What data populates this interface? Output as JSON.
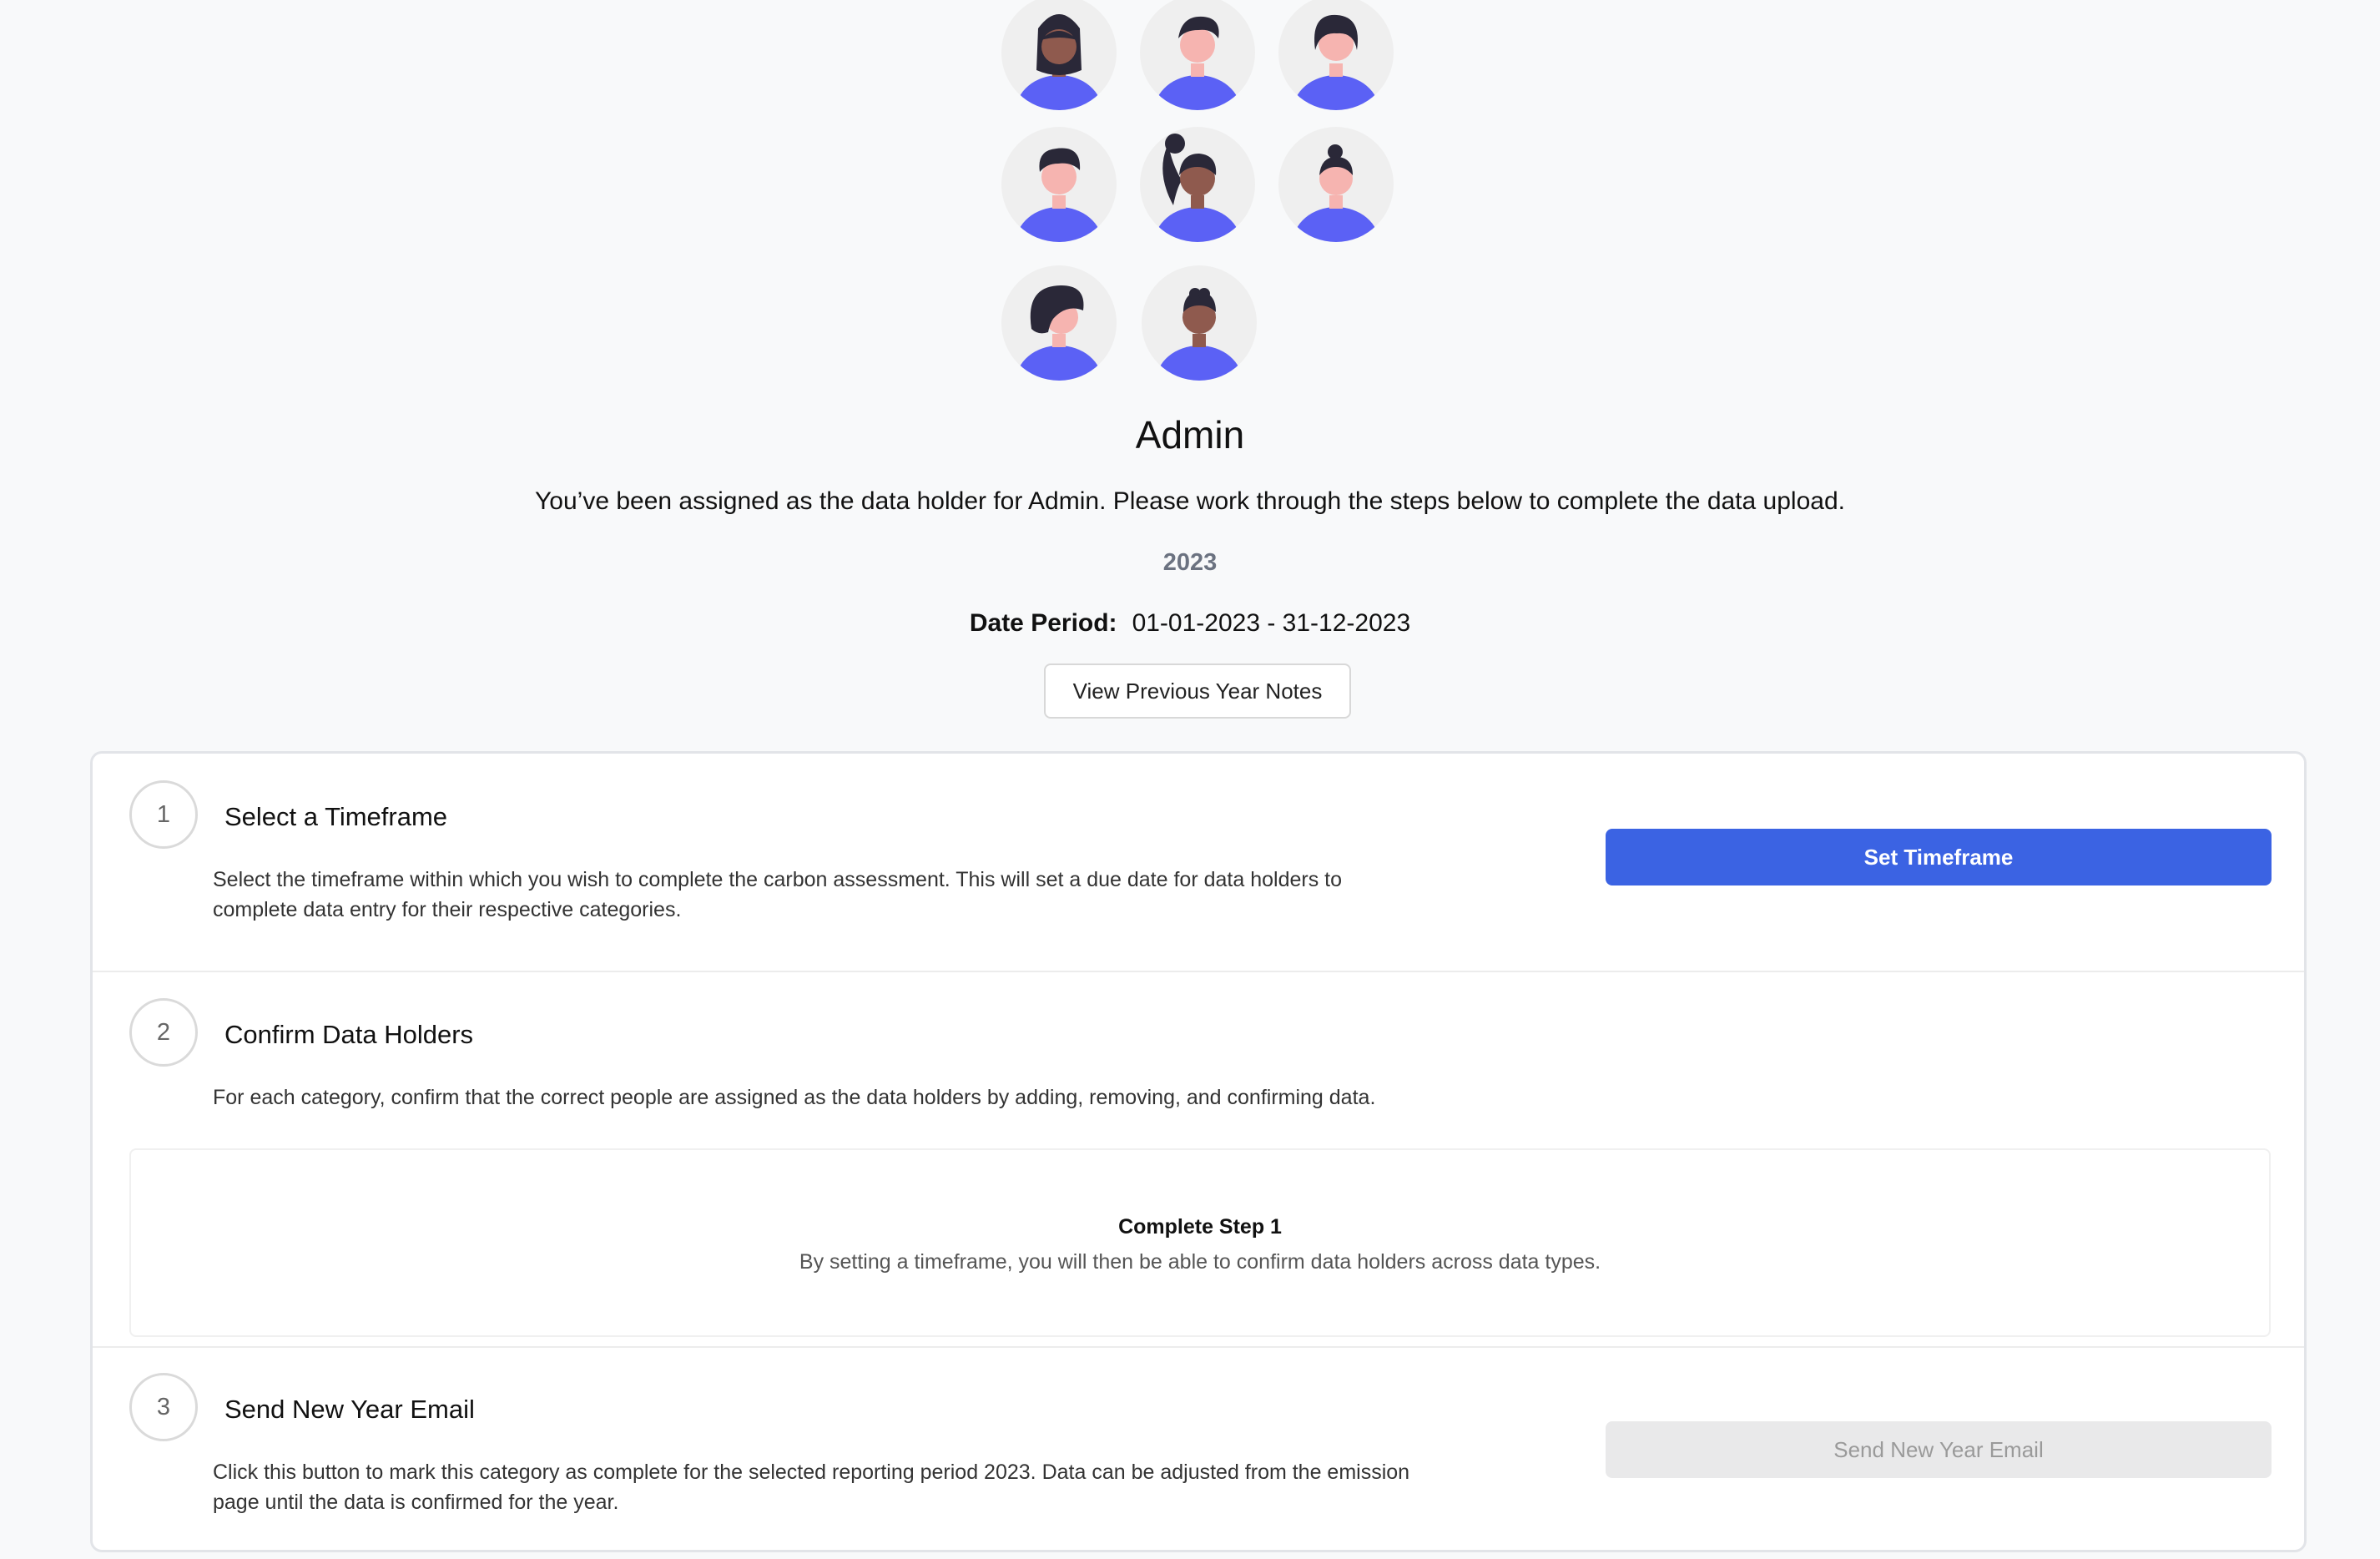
{
  "header": {
    "role_title": "Admin",
    "assignment_message": "You’ve been assigned as the data holder for Admin. Please work through the steps below to complete the data upload.",
    "year": "2023",
    "date_period_label": "Date Period:",
    "date_period_value": "01-01-2023 - 31-12-2023",
    "previous_notes_button": "View Previous Year Notes"
  },
  "avatars": [
    {
      "name": "avatar-1",
      "skin": "#8f5a4e",
      "hair": "long-dark"
    },
    {
      "name": "avatar-2",
      "skin": "#f6b4b0",
      "hair": "short-dark"
    },
    {
      "name": "avatar-3",
      "skin": "#f6b4b0",
      "hair": "bob-dark"
    },
    {
      "name": "avatar-4",
      "skin": "#f6b4b0",
      "hair": "curly-dark"
    },
    {
      "name": "avatar-5",
      "skin": "#8f5a4e",
      "hair": "ponytail-dark"
    },
    {
      "name": "avatar-6",
      "skin": "#f6b4b0",
      "hair": "bun-dark"
    },
    {
      "name": "avatar-7",
      "skin": "#f6b4b0",
      "hair": "side-swept-dark"
    },
    {
      "name": "avatar-8",
      "skin": "#8f5a4e",
      "hair": "short-curly-dark"
    }
  ],
  "steps": [
    {
      "number": "1",
      "title": "Select a Timeframe",
      "description_line1": "Select the timeframe within which you wish to complete the carbon assessment. This will set a due date for data holders to",
      "description_line2": "complete data entry for their respective categories.",
      "button_label": "Set Timeframe"
    },
    {
      "number": "2",
      "title": "Confirm Data Holders",
      "description_line1": "For each category, confirm that the correct people are assigned as the data holders by adding, removing, and confirming data.",
      "empty_state_title": "Complete Step 1",
      "empty_state_message": "By setting a timeframe, you will then be able to confirm data holders across data types."
    },
    {
      "number": "3",
      "title": "Send New Year Email",
      "description_line1": "Click this button to mark this category as complete for the selected reporting period 2023. Data can be adjusted from the emission",
      "description_line2": "page until the data is confirmed for the year.",
      "button_label": "Send New Year Email"
    }
  ],
  "colors": {
    "primary": "#3b63e3",
    "avatar_shirt": "#5b61f5",
    "avatar_bg": "#efefef",
    "hair": "#2a2838",
    "disabled_bg": "#e9e9ea"
  }
}
